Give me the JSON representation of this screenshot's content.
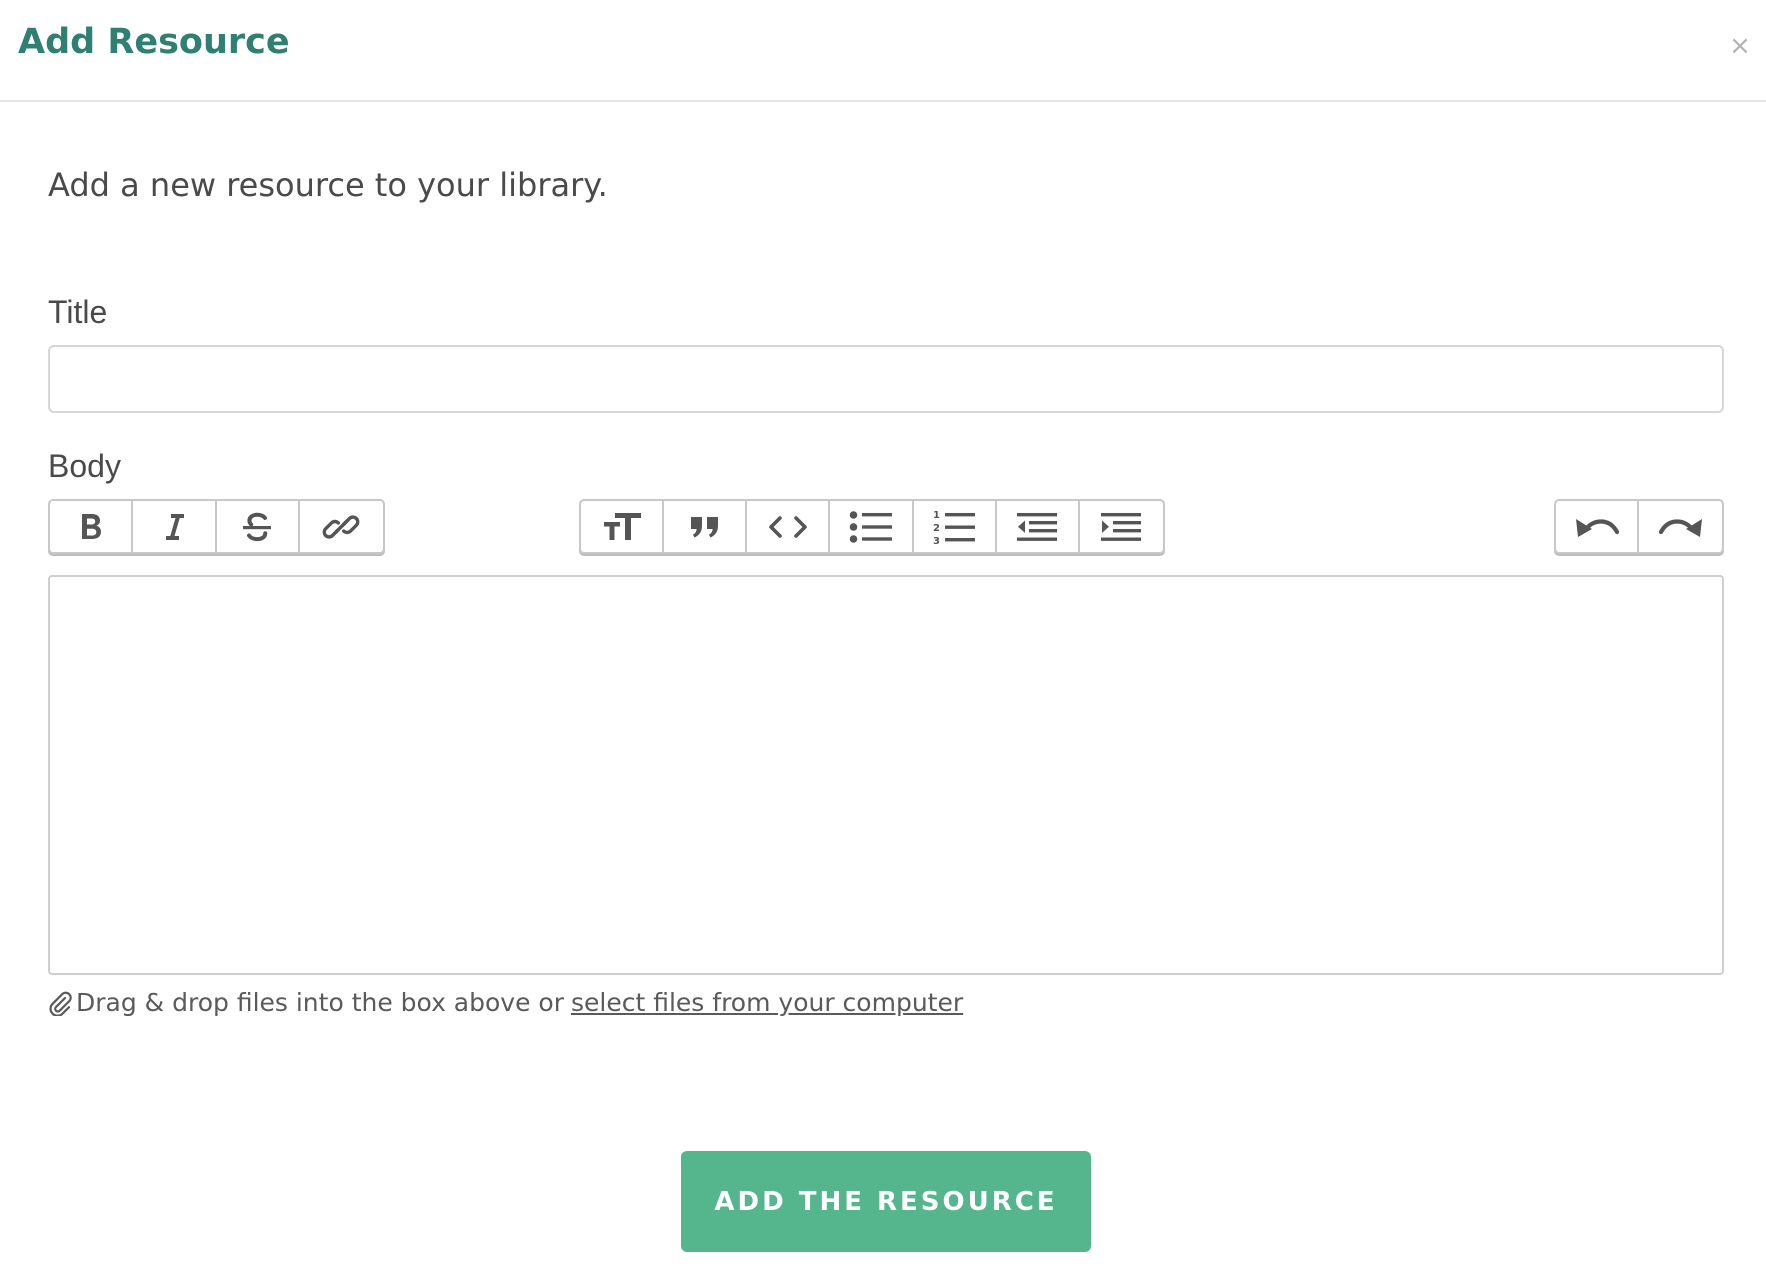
{
  "dialog": {
    "title": "Add Resource",
    "close_glyph": "×"
  },
  "intro_text": "Add a new resource to your library.",
  "form": {
    "title_label": "Title",
    "title_value": "",
    "body_label": "Body",
    "body_value": ""
  },
  "toolbar": {
    "format_buttons": [
      "bold-icon",
      "italic-icon",
      "strikethrough-icon",
      "link-icon"
    ],
    "block_buttons": [
      "heading-icon",
      "quote-icon",
      "code-icon",
      "bullet-list-icon",
      "numbered-list-icon",
      "decrease-indent-icon",
      "increase-indent-icon"
    ],
    "history_buttons": [
      "undo-icon",
      "redo-icon"
    ]
  },
  "attach": {
    "icon": "paperclip-icon",
    "text": "Drag & drop files into the box above or",
    "link_text": "select files from your computer"
  },
  "submit_label": "ADD THE RESOURCE",
  "colors": {
    "title": "#2f7f72",
    "primary_button": "#55b58c"
  }
}
